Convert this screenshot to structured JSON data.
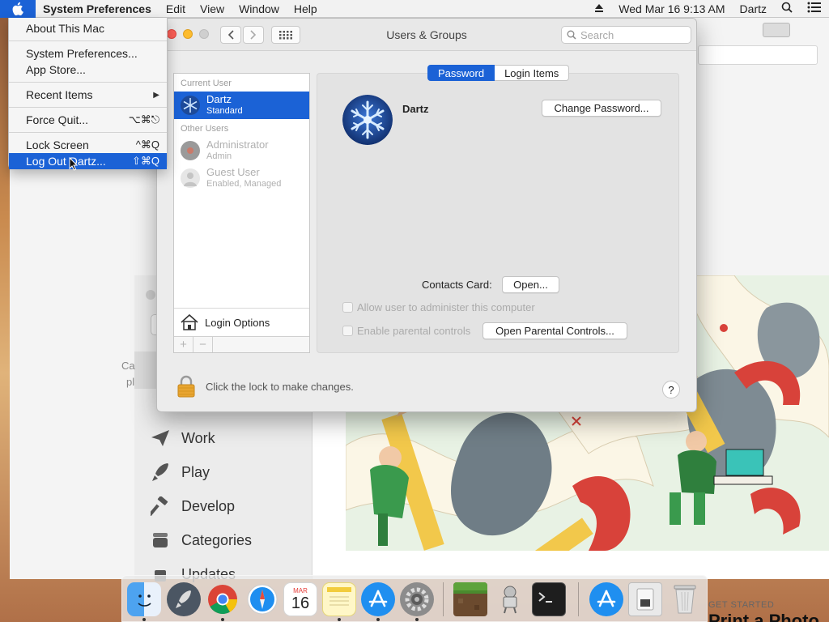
{
  "menubar": {
    "app_name": "System Preferences",
    "menus": [
      "Edit",
      "View",
      "Window",
      "Help"
    ],
    "datetime": "Wed Mar 16  9:13 AM",
    "user": "Dartz"
  },
  "apple_menu": {
    "items": [
      {
        "label": "About This Mac",
        "shortcut": ""
      },
      {
        "label": "System Preferences...",
        "shortcut": ""
      },
      {
        "label": "App Store...",
        "shortcut": ""
      },
      {
        "label": "Recent Items",
        "shortcut": ""
      },
      {
        "label": "Force Quit...",
        "shortcut": "⌥⌘⎋"
      },
      {
        "label": "Lock Screen",
        "shortcut": "^⌘Q"
      },
      {
        "label": "Log Out Dartz...",
        "shortcut": "⇧⌘Q"
      }
    ]
  },
  "window": {
    "title": "Users & Groups",
    "search_placeholder": "Search"
  },
  "user_list": {
    "current_heading": "Current User",
    "other_heading": "Other Users",
    "users": [
      {
        "name": "Dartz",
        "role": "Standard"
      },
      {
        "name": "Administrator",
        "role": "Admin"
      },
      {
        "name": "Guest User",
        "role": "Enabled, Managed"
      }
    ],
    "login_options": "Login Options",
    "add": "+",
    "remove": "−"
  },
  "tabs": [
    "Password",
    "Login Items"
  ],
  "detail": {
    "user_name": "Dartz",
    "change_password": "Change Password...",
    "contacts_label": "Contacts Card:",
    "open": "Open...",
    "allow_admin": "Allow user to administer this computer",
    "parental_controls": "Enable parental controls",
    "open_parental": "Open Parental Controls..."
  },
  "lock_text": "Click the lock to make changes.",
  "help": "?",
  "appstore": {
    "nav": [
      "Work",
      "Play",
      "Develop",
      "Categories",
      "Updates"
    ],
    "frag1": "Ca",
    "frag2": "pl",
    "get_started": "GET STARTED",
    "print_photo": "Print a Photo"
  },
  "dock": {
    "calendar_month": "MAR",
    "calendar_day": "16",
    "items": [
      "Finder",
      "Launchpad",
      "Chrome",
      "Safari",
      "Calendar",
      "Notes",
      "App Store",
      "System Preferences",
      "Minecraft",
      "Automator",
      "Terminal",
      "Applications",
      "Downloads",
      "Trash"
    ]
  },
  "colors": {
    "accent": "#1b62d6",
    "close": "#fc5f57",
    "minimize": "#fdbc2e"
  }
}
